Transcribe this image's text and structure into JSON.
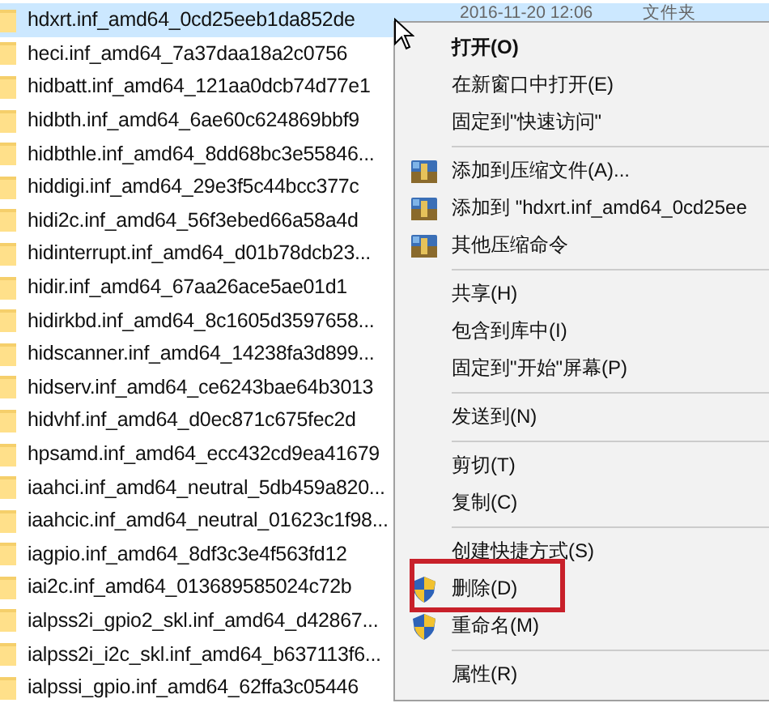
{
  "files": [
    {
      "name": "hdxrt.inf_amd64_0cd25eeb1da852de",
      "selected": true,
      "date": "2016-11-20 12:06",
      "type": "文件夹"
    },
    {
      "name": "heci.inf_amd64_7a37daa18a2c0756",
      "selected": false
    },
    {
      "name": "hidbatt.inf_amd64_121aa0dcb74d77e1",
      "selected": false
    },
    {
      "name": "hidbth.inf_amd64_6ae60c624869bbf9",
      "selected": false
    },
    {
      "name": "hidbthle.inf_amd64_8dd68bc3e55846...",
      "selected": false
    },
    {
      "name": "hiddigi.inf_amd64_29e3f5c44bcc377c",
      "selected": false
    },
    {
      "name": "hidi2c.inf_amd64_56f3ebed66a58a4d",
      "selected": false
    },
    {
      "name": "hidinterrupt.inf_amd64_d01b78dcb23...",
      "selected": false
    },
    {
      "name": "hidir.inf_amd64_67aa26ace5ae01d1",
      "selected": false
    },
    {
      "name": "hidirkbd.inf_amd64_8c1605d3597658...",
      "selected": false
    },
    {
      "name": "hidscanner.inf_amd64_14238fa3d899...",
      "selected": false
    },
    {
      "name": "hidserv.inf_amd64_ce6243bae64b3013",
      "selected": false
    },
    {
      "name": "hidvhf.inf_amd64_d0ec871c675fec2d",
      "selected": false
    },
    {
      "name": "hpsamd.inf_amd64_ecc432cd9ea41679",
      "selected": false
    },
    {
      "name": "iaahci.inf_amd64_neutral_5db459a820...",
      "selected": false
    },
    {
      "name": "iaahcic.inf_amd64_neutral_01623c1f98...",
      "selected": false
    },
    {
      "name": "iagpio.inf_amd64_8df3c3e4f563fd12",
      "selected": false
    },
    {
      "name": "iai2c.inf_amd64_013689585024c72b",
      "selected": false
    },
    {
      "name": "ialpss2i_gpio2_skl.inf_amd64_d42867...",
      "selected": false
    },
    {
      "name": "ialpss2i_i2c_skl.inf_amd64_b637113f6...",
      "selected": false
    },
    {
      "name": "ialpssi_gpio.inf_amd64_62ffa3c05446",
      "selected": false
    }
  ],
  "context_menu": {
    "items": [
      {
        "kind": "default",
        "label": "打开(O)",
        "marked": false
      },
      {
        "kind": "item",
        "label": "在新窗口中打开(E)",
        "marked": false
      },
      {
        "kind": "item",
        "label": "固定到\"快速访问\"",
        "marked": false
      },
      {
        "kind": "separator"
      },
      {
        "kind": "archive",
        "label": "添加到压缩文件(A)...",
        "marked": false
      },
      {
        "kind": "archive",
        "label": "添加到 \"hdxrt.inf_amd64_0cd25ee",
        "marked": false
      },
      {
        "kind": "archive",
        "label": "其他压缩命令",
        "marked": false
      },
      {
        "kind": "separator"
      },
      {
        "kind": "item",
        "label": "共享(H)",
        "marked": false
      },
      {
        "kind": "item",
        "label": "包含到库中(I)",
        "marked": false
      },
      {
        "kind": "item",
        "label": "固定到\"开始\"屏幕(P)",
        "marked": false
      },
      {
        "kind": "separator"
      },
      {
        "kind": "item",
        "label": "发送到(N)",
        "marked": false
      },
      {
        "kind": "separator"
      },
      {
        "kind": "item",
        "label": "剪切(T)",
        "marked": false
      },
      {
        "kind": "item",
        "label": "复制(C)",
        "marked": false
      },
      {
        "kind": "separator"
      },
      {
        "kind": "item",
        "label": "创建快捷方式(S)",
        "marked": false
      },
      {
        "kind": "shield",
        "label": "删除(D)",
        "marked": true
      },
      {
        "kind": "shield",
        "label": "重命名(M)",
        "marked": false
      },
      {
        "kind": "separator"
      },
      {
        "kind": "item",
        "label": "属性(R)",
        "marked": false
      }
    ]
  }
}
